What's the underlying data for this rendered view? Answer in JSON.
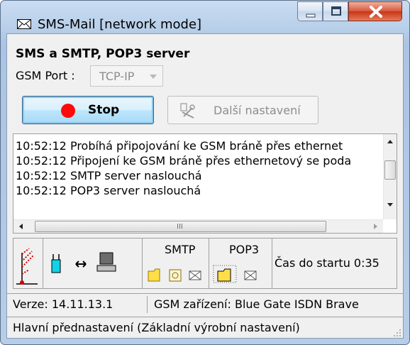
{
  "window": {
    "title": "SMS-Mail  [network mode]",
    "icons": [
      "envelope-icon",
      "minimize-icon",
      "maximize-icon",
      "close-icon"
    ]
  },
  "main": {
    "heading": "SMS a SMTP, POP3 server",
    "gsm_port_label": "GSM Port :",
    "gsm_port_value": "TCP-IP",
    "stop_label": "Stop",
    "more_settings_label": "Další nastavení"
  },
  "log": {
    "lines": [
      "10:52:12  Probíhá připojování ke GSM bráně přes ethernet",
      "10:52:12  Připojení ke GSM bráně přes ethernetový se poda",
      "10:52:12  SMTP server naslouchá",
      "10:52:12  POP3 server naslouchá"
    ],
    "scrollbar_grip": "III"
  },
  "status_panel": {
    "smtp_label": "SMTP",
    "pop3_label": "POP3",
    "countdown": "Čas do startu 0:35"
  },
  "statusbar": {
    "version": "Verze: 14.11.13.1",
    "device": "GSM zařízení: Blue Gate ISDN Brave",
    "preset": "Hlavní přednastavení (Základní výrobní nastavení)"
  },
  "colors": {
    "accent": "#2c628b",
    "stop_dot": "#ff0a0a",
    "folder_yellow": "#ffde48",
    "titlebar": "#c9dcf2"
  }
}
